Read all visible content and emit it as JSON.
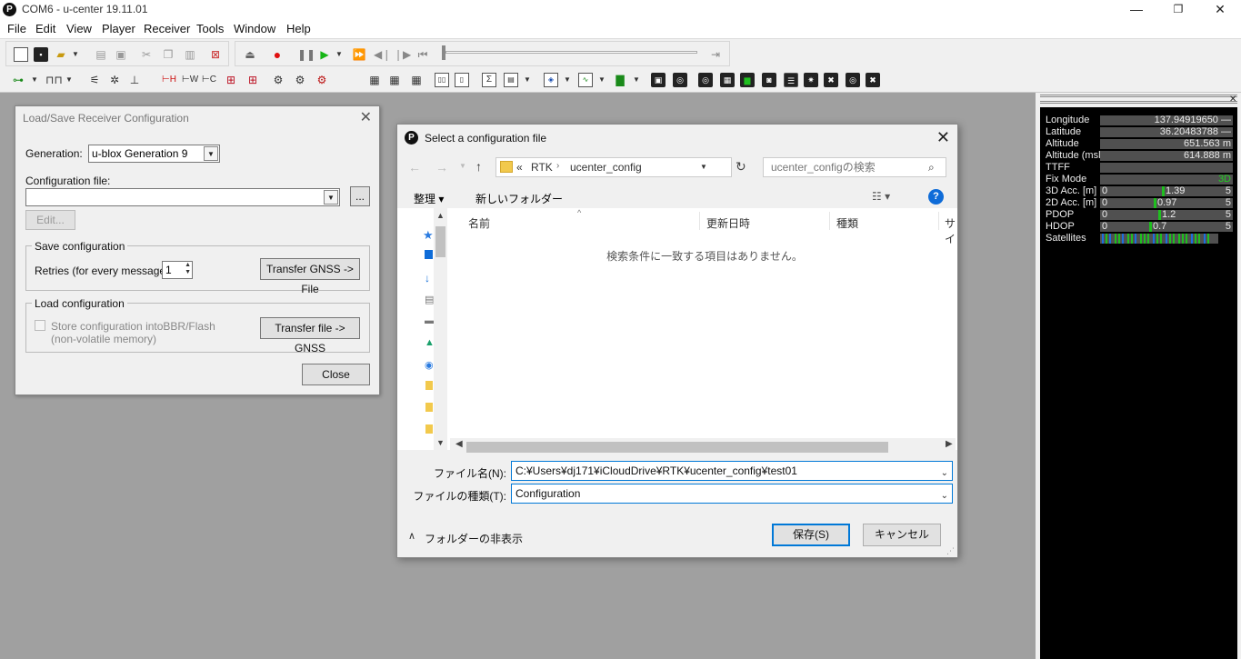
{
  "window": {
    "title": "COM6 - u-center 19.11.01",
    "logo_letter": "P",
    "min_glyph": "—",
    "max_glyph": "❐",
    "close_glyph": "✕"
  },
  "menu": [
    "File",
    "Edit",
    "View",
    "Player",
    "Receiver",
    "Tools",
    "Window",
    "Help"
  ],
  "left_dialog": {
    "title": "Load/Save Receiver Configuration",
    "generation_label": "Generation:",
    "generation_value": "u-blox Generation 9",
    "config_file_label": "Configuration file:",
    "config_file_value": "",
    "browse_label": "...",
    "edit_label": "Edit...",
    "save_group_title": "Save configuration",
    "retries_label": "Retries (for every message):",
    "retries_value": "1",
    "transfer_gnss_file_label": "Transfer GNSS -> File",
    "load_group_title": "Load configuration",
    "store_bbr_label": "Store configuration intoBBR/Flash",
    "store_bbr_sublabel": "(non-volatile memory)",
    "store_bbr_checked": false,
    "transfer_file_gnss_label": "Transfer file -> GNSS",
    "close_label": "Close"
  },
  "file_dialog": {
    "title": "Select a configuration file",
    "breadcrumb": [
      "«",
      "RTK",
      "ucenter_config"
    ],
    "search_placeholder": "ucenter_configの検索",
    "organize_label": "整理 ▾",
    "new_folder_label": "新しいフォルダー",
    "columns": [
      "名前",
      "更新日時",
      "種類",
      "サイ"
    ],
    "empty_message": "検索条件に一致する項目はありません。",
    "filename_label": "ファイル名(N):",
    "filename_value": "C:¥Users¥dj171¥iCloudDrive¥RTK¥ucenter_config¥test01",
    "filetype_label": "ファイルの種類(T):",
    "filetype_value": "Configuration",
    "hide_folders_label": "フォルダーの非表示",
    "save_label": "保存(S)",
    "cancel_label": "キャンセル"
  },
  "status_panel": {
    "rows": [
      {
        "label": "Longitude",
        "value": "137.94919650 —"
      },
      {
        "label": "Latitude",
        "value": "36.20483788 —"
      },
      {
        "label": "Altitude",
        "value": "651.563 m"
      },
      {
        "label": "Altitude (msl)",
        "value": "614.888 m"
      },
      {
        "label": "TTFF",
        "value": ""
      },
      {
        "label": "Fix Mode",
        "value": "3D"
      }
    ],
    "accuracy_rows": [
      {
        "label": "3D Acc. [m]",
        "min": "0",
        "value": "1.39",
        "max": "5",
        "level": 1.39
      },
      {
        "label": "2D Acc. [m]",
        "min": "0",
        "value": "0.97",
        "max": "5",
        "level": 0.97
      },
      {
        "label": "PDOP",
        "min": "0",
        "value": "1.2",
        "max": "5",
        "level": 1.2
      },
      {
        "label": "HDOP",
        "min": "0",
        "value": "0.7",
        "max": "5",
        "level": 0.7
      }
    ],
    "satellites_label": "Satellites",
    "colors": {
      "good": "#1fbf1f",
      "used": "#1c6fe0",
      "bar_bg": "#505050"
    }
  }
}
